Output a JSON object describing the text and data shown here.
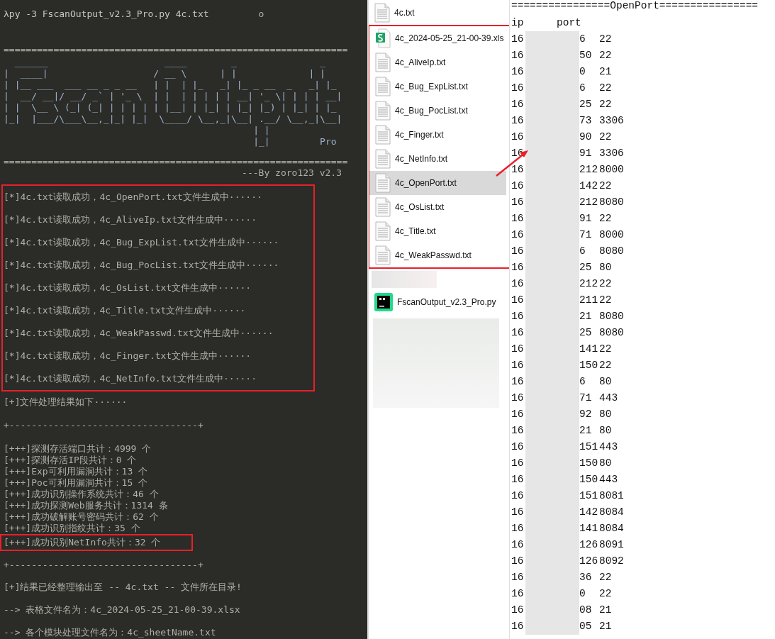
{
  "terminal": {
    "command": "λpy -3 FscanOutput_v2.3_Pro.py 4c.txt",
    "cursor": "o",
    "rule_top": "==============================================================",
    "banner": [
      "  ______                     ____        _               _",
      "|  ____|                   / __ \\      | |             | |",
      "| |__ ___  ___ __ _ _ __   | |  | |_   _| |_ _ __  _   _| |_",
      "|  __/ __|/ __/ _` | '_ \\  | |  | | | | | __| '_ \\| | | | __|",
      "| |  \\__ \\ (_| (_| | | | | | |__| | |_| | |_| |_) | |_| | |_",
      "|_|  |___/\\___\\__,_|_| |_|  \\____/ \\__,_|\\__| .__/ \\__,_|\\__|",
      "                                             | |",
      "                                             |_|         Pro"
    ],
    "rule_bottom": "==============================================================",
    "byline": "---By zoro123 v2.3",
    "read_block": {
      "highlighted": true,
      "lines": [
        "[*]4c.txt读取成功，4c_OpenPort.txt文件生成中······",
        "[*]4c.txt读取成功，4c_AliveIp.txt文件生成中······",
        "[*]4c.txt读取成功，4c_Bug_ExpList.txt文件生成中······",
        "[*]4c.txt读取成功，4c_Bug_PocList.txt文件生成中······",
        "[*]4c.txt读取成功，4c_OsList.txt文件生成中······",
        "[*]4c.txt读取成功，4c_Title.txt文件生成中······",
        "[*]4c.txt读取成功，4c_WeakPasswd.txt文件生成中······",
        "[*]4c.txt读取成功，4c_Finger.txt文件生成中······",
        "[*]4c.txt读取成功，4c_NetInfo.txt文件生成中······"
      ]
    },
    "summary_header": "[+]文件处理结果如下······",
    "table_border_top": "+----------------------------------+",
    "stats": [
      {
        "text": "[+++]探测存活端口共计：4999 个",
        "highlighted": false
      },
      {
        "text": "[+++]探测存活IP段共计：0 个",
        "highlighted": false
      },
      {
        "text": "[+++]Exp可利用漏洞共计：13 个",
        "highlighted": false
      },
      {
        "text": "[+++]Poc可利用漏洞共计：15 个",
        "highlighted": false
      },
      {
        "text": "[+++]成功识别操作系统共计：46 个",
        "highlighted": false
      },
      {
        "text": "[+++]成功探测Web服务共计：1314 条",
        "highlighted": false
      },
      {
        "text": "[+++]成功破解账号密码共计：62 个",
        "highlighted": false
      },
      {
        "text": "[+++]成功识别指纹共计：35 个",
        "highlighted": false
      },
      {
        "text": "[+++]成功识别NetInfo共计：32 个",
        "highlighted": true
      }
    ],
    "table_border_bottom": "+----------------------------------+",
    "conclusion": "[+]结果已经整理输出至 -- 4c.txt -- 文件所在目录!",
    "outputs": [
      "--> 表格文件名为：4c_2024-05-25_21-00-39.xlsx",
      "--> 各个模块处理文件名为：4c_sheetName.txt"
    ]
  },
  "file_groups": [
    {
      "highlighted": false,
      "files": [
        {
          "kind": "text",
          "name": "4c.txt",
          "selected": false
        }
      ]
    },
    {
      "highlighted": true,
      "files": [
        {
          "kind": "sheet",
          "name": "4c_2024-05-25_21-00-39.xls",
          "selected": false
        },
        {
          "kind": "text",
          "name": "4c_AliveIp.txt",
          "selected": false
        },
        {
          "kind": "text",
          "name": "4c_Bug_ExpList.txt",
          "selected": false
        },
        {
          "kind": "text",
          "name": "4c_Bug_PocList.txt",
          "selected": false
        },
        {
          "kind": "text",
          "name": "4c_Finger.txt",
          "selected": false
        },
        {
          "kind": "text",
          "name": "4c_NetInfo.txt",
          "selected": false
        },
        {
          "kind": "text",
          "name": "4c_OpenPort.txt",
          "selected": true
        },
        {
          "kind": "text",
          "name": "4c_OsList.txt",
          "selected": false
        },
        {
          "kind": "text",
          "name": "4c_Title.txt",
          "selected": false
        },
        {
          "kind": "text",
          "name": "4c_WeakPasswd.txt",
          "selected": false
        }
      ]
    },
    {
      "highlighted": false,
      "files": [
        {
          "kind": "blurred",
          "selected": false
        },
        {
          "kind": "script",
          "name": "FscanOutput_v2.3_Pro.py",
          "selected": false
        },
        {
          "kind": "blurred_large",
          "selected": false
        }
      ]
    }
  ],
  "openport_file": {
    "title": "================OpenPort================",
    "columns": [
      "ip",
      "port"
    ],
    "rows": [
      {
        "ip_start": "16",
        "ip_end": "6",
        "port": "22"
      },
      {
        "ip_start": "16",
        "ip_end": "50",
        "port": "22"
      },
      {
        "ip_start": "16",
        "ip_end": "0",
        "port": "21"
      },
      {
        "ip_start": "16",
        "ip_end": "6",
        "port": "22"
      },
      {
        "ip_start": "16",
        "ip_end": "25",
        "port": "22"
      },
      {
        "ip_start": "16",
        "ip_end": "73",
        "port": "3306"
      },
      {
        "ip_start": "16",
        "ip_end": "90",
        "port": "22"
      },
      {
        "ip_start": "16",
        "ip_end": "91",
        "port": "3306"
      },
      {
        "ip_start": "16",
        "ip_end": "212",
        "port": "8000"
      },
      {
        "ip_start": "16",
        "ip_end": "142",
        "port": "22"
      },
      {
        "ip_start": "16",
        "ip_end": "212",
        "port": "8080"
      },
      {
        "ip_start": "16",
        "ip_end": "91",
        "port": "22"
      },
      {
        "ip_start": "16",
        "ip_end": "71",
        "port": "8000"
      },
      {
        "ip_start": "16",
        "ip_end": "6",
        "port": "8080"
      },
      {
        "ip_start": "16",
        "ip_end": "25",
        "port": "80"
      },
      {
        "ip_start": "16",
        "ip_end": "212",
        "port": "22"
      },
      {
        "ip_start": "16",
        "ip_end": "211",
        "port": "22"
      },
      {
        "ip_start": "16",
        "ip_end": "21",
        "port": "8080"
      },
      {
        "ip_start": "16",
        "ip_end": "25",
        "port": "8080"
      },
      {
        "ip_start": "16",
        "ip_end": "141",
        "port": "22"
      },
      {
        "ip_start": "16",
        "ip_end": "150",
        "port": "22"
      },
      {
        "ip_start": "16",
        "ip_end": "6",
        "port": "80"
      },
      {
        "ip_start": "16",
        "ip_end": "71",
        "port": "443"
      },
      {
        "ip_start": "16",
        "ip_end": "92",
        "port": "80"
      },
      {
        "ip_start": "16",
        "ip_end": "21",
        "port": "80"
      },
      {
        "ip_start": "16",
        "ip_end": "151",
        "port": "443"
      },
      {
        "ip_start": "16",
        "ip_end": "150",
        "port": "80"
      },
      {
        "ip_start": "16",
        "ip_end": "150",
        "port": "443"
      },
      {
        "ip_start": "16",
        "ip_end": "151",
        "port": "8081"
      },
      {
        "ip_start": "16",
        "ip_end": "142",
        "port": "8084"
      },
      {
        "ip_start": "16",
        "ip_end": "141",
        "port": "8084"
      },
      {
        "ip_start": "16",
        "ip_end": "126",
        "port": "8091"
      },
      {
        "ip_start": "16",
        "ip_end": "126",
        "port": "8092"
      },
      {
        "ip_start": "16",
        "ip_end": "36",
        "port": "22"
      },
      {
        "ip_start": "16",
        "ip_end": "0",
        "port": "22"
      },
      {
        "ip_start": "16",
        "ip_end": "08",
        "port": "21"
      },
      {
        "ip_start": "16",
        "ip_end": "05",
        "port": "21"
      }
    ]
  }
}
